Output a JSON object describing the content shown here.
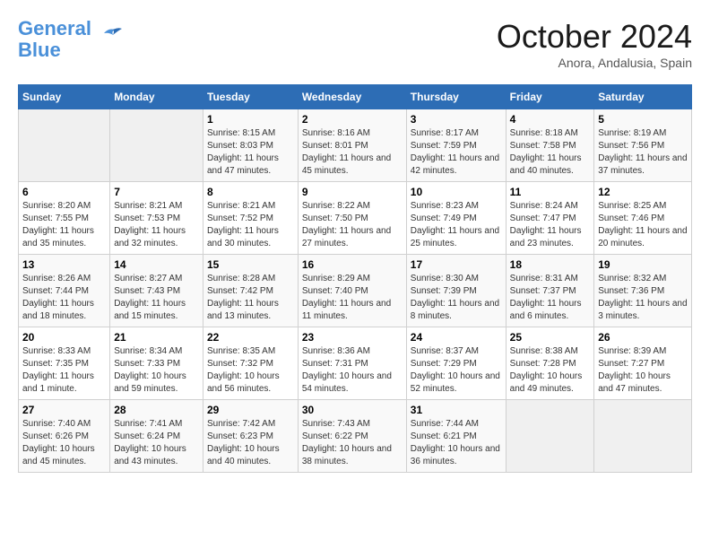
{
  "header": {
    "logo_line1": "General",
    "logo_line2": "Blue",
    "month": "October 2024",
    "location": "Anora, Andalusia, Spain"
  },
  "weekdays": [
    "Sunday",
    "Monday",
    "Tuesday",
    "Wednesday",
    "Thursday",
    "Friday",
    "Saturday"
  ],
  "weeks": [
    [
      {
        "day": "",
        "info": ""
      },
      {
        "day": "",
        "info": ""
      },
      {
        "day": "1",
        "info": "Sunrise: 8:15 AM\nSunset: 8:03 PM\nDaylight: 11 hours and 47 minutes."
      },
      {
        "day": "2",
        "info": "Sunrise: 8:16 AM\nSunset: 8:01 PM\nDaylight: 11 hours and 45 minutes."
      },
      {
        "day": "3",
        "info": "Sunrise: 8:17 AM\nSunset: 7:59 PM\nDaylight: 11 hours and 42 minutes."
      },
      {
        "day": "4",
        "info": "Sunrise: 8:18 AM\nSunset: 7:58 PM\nDaylight: 11 hours and 40 minutes."
      },
      {
        "day": "5",
        "info": "Sunrise: 8:19 AM\nSunset: 7:56 PM\nDaylight: 11 hours and 37 minutes."
      }
    ],
    [
      {
        "day": "6",
        "info": "Sunrise: 8:20 AM\nSunset: 7:55 PM\nDaylight: 11 hours and 35 minutes."
      },
      {
        "day": "7",
        "info": "Sunrise: 8:21 AM\nSunset: 7:53 PM\nDaylight: 11 hours and 32 minutes."
      },
      {
        "day": "8",
        "info": "Sunrise: 8:21 AM\nSunset: 7:52 PM\nDaylight: 11 hours and 30 minutes."
      },
      {
        "day": "9",
        "info": "Sunrise: 8:22 AM\nSunset: 7:50 PM\nDaylight: 11 hours and 27 minutes."
      },
      {
        "day": "10",
        "info": "Sunrise: 8:23 AM\nSunset: 7:49 PM\nDaylight: 11 hours and 25 minutes."
      },
      {
        "day": "11",
        "info": "Sunrise: 8:24 AM\nSunset: 7:47 PM\nDaylight: 11 hours and 23 minutes."
      },
      {
        "day": "12",
        "info": "Sunrise: 8:25 AM\nSunset: 7:46 PM\nDaylight: 11 hours and 20 minutes."
      }
    ],
    [
      {
        "day": "13",
        "info": "Sunrise: 8:26 AM\nSunset: 7:44 PM\nDaylight: 11 hours and 18 minutes."
      },
      {
        "day": "14",
        "info": "Sunrise: 8:27 AM\nSunset: 7:43 PM\nDaylight: 11 hours and 15 minutes."
      },
      {
        "day": "15",
        "info": "Sunrise: 8:28 AM\nSunset: 7:42 PM\nDaylight: 11 hours and 13 minutes."
      },
      {
        "day": "16",
        "info": "Sunrise: 8:29 AM\nSunset: 7:40 PM\nDaylight: 11 hours and 11 minutes."
      },
      {
        "day": "17",
        "info": "Sunrise: 8:30 AM\nSunset: 7:39 PM\nDaylight: 11 hours and 8 minutes."
      },
      {
        "day": "18",
        "info": "Sunrise: 8:31 AM\nSunset: 7:37 PM\nDaylight: 11 hours and 6 minutes."
      },
      {
        "day": "19",
        "info": "Sunrise: 8:32 AM\nSunset: 7:36 PM\nDaylight: 11 hours and 3 minutes."
      }
    ],
    [
      {
        "day": "20",
        "info": "Sunrise: 8:33 AM\nSunset: 7:35 PM\nDaylight: 11 hours and 1 minute."
      },
      {
        "day": "21",
        "info": "Sunrise: 8:34 AM\nSunset: 7:33 PM\nDaylight: 10 hours and 59 minutes."
      },
      {
        "day": "22",
        "info": "Sunrise: 8:35 AM\nSunset: 7:32 PM\nDaylight: 10 hours and 56 minutes."
      },
      {
        "day": "23",
        "info": "Sunrise: 8:36 AM\nSunset: 7:31 PM\nDaylight: 10 hours and 54 minutes."
      },
      {
        "day": "24",
        "info": "Sunrise: 8:37 AM\nSunset: 7:29 PM\nDaylight: 10 hours and 52 minutes."
      },
      {
        "day": "25",
        "info": "Sunrise: 8:38 AM\nSunset: 7:28 PM\nDaylight: 10 hours and 49 minutes."
      },
      {
        "day": "26",
        "info": "Sunrise: 8:39 AM\nSunset: 7:27 PM\nDaylight: 10 hours and 47 minutes."
      }
    ],
    [
      {
        "day": "27",
        "info": "Sunrise: 7:40 AM\nSunset: 6:26 PM\nDaylight: 10 hours and 45 minutes."
      },
      {
        "day": "28",
        "info": "Sunrise: 7:41 AM\nSunset: 6:24 PM\nDaylight: 10 hours and 43 minutes."
      },
      {
        "day": "29",
        "info": "Sunrise: 7:42 AM\nSunset: 6:23 PM\nDaylight: 10 hours and 40 minutes."
      },
      {
        "day": "30",
        "info": "Sunrise: 7:43 AM\nSunset: 6:22 PM\nDaylight: 10 hours and 38 minutes."
      },
      {
        "day": "31",
        "info": "Sunrise: 7:44 AM\nSunset: 6:21 PM\nDaylight: 10 hours and 36 minutes."
      },
      {
        "day": "",
        "info": ""
      },
      {
        "day": "",
        "info": ""
      }
    ]
  ]
}
